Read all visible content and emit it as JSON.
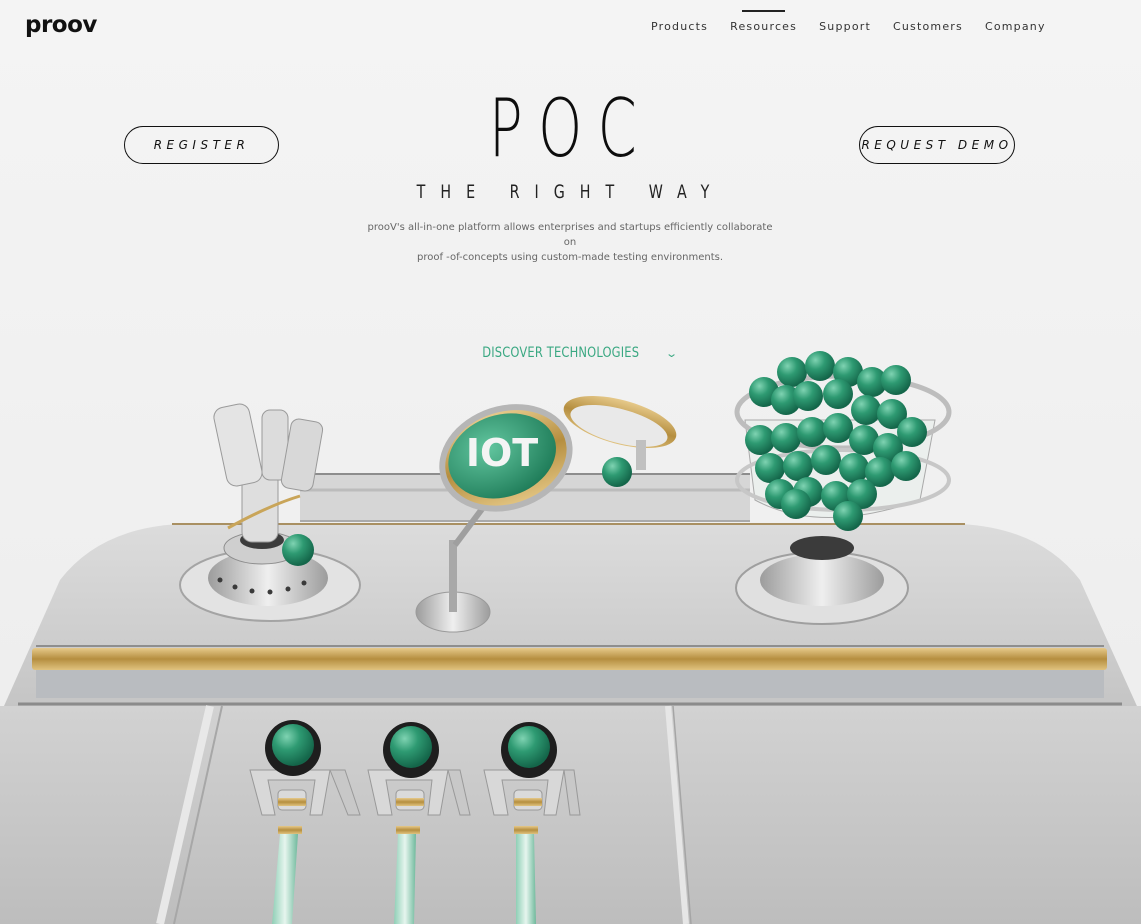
{
  "header": {
    "logo": "proov",
    "nav": [
      "Products",
      "Resources",
      "Support",
      "Customers",
      "Company"
    ],
    "active_nav": "Resources"
  },
  "hero": {
    "title": "POC",
    "subtitle": "THE RIGHT WAY",
    "description_line1": "prooV's all-in-one platform allows enterprises and startups efficiently collaborate on",
    "description_line2": "proof -of-concepts using custom-made testing environments.",
    "register_label": "REGISTER",
    "demo_label": "REQUEST DEMO",
    "discover_label": "DISCOVER TECHNOLOGIES"
  },
  "illustration": {
    "iot_label": "IOT",
    "accent": "#2e9a72",
    "gold": "#c9a559",
    "metal": "#c8c8c8"
  }
}
